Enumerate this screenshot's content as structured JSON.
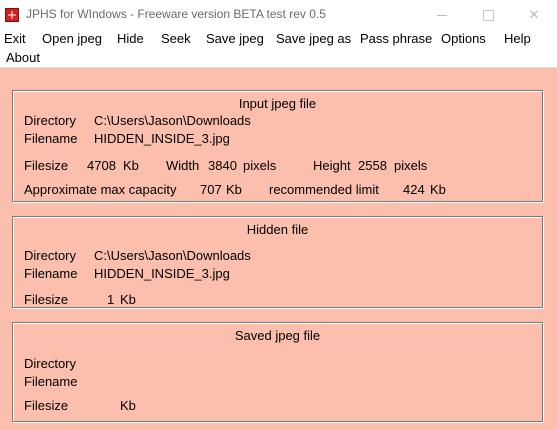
{
  "window": {
    "title": "JPHS for WIndows - Freeware version BETA test rev 0.5",
    "close_glyph": "✕"
  },
  "menu": {
    "items": [
      "Exit",
      "Open jpeg",
      "Hide",
      "Seek",
      "Save jpeg",
      "Save jpeg as",
      "Pass phrase",
      "Options",
      "Help",
      "About"
    ]
  },
  "input_jpeg": {
    "title": "Input jpeg file",
    "directory_label": "Directory",
    "directory_value": "C:\\Users\\Jason\\Downloads",
    "filename_label": "Filename",
    "filename_value": "HIDDEN_INSIDE_3.jpg",
    "filesize_label": "Filesize",
    "filesize_value": "4708",
    "filesize_unit": "Kb",
    "width_label": "Width",
    "width_value": "3840",
    "width_unit": "pixels",
    "height_label": "Height",
    "height_value": "2558",
    "height_unit": "pixels",
    "capacity_label": "Approximate max capacity",
    "capacity_value": "707",
    "capacity_unit": "Kb",
    "limit_label": "recommended limit",
    "limit_value": "424",
    "limit_unit": "Kb"
  },
  "hidden_file": {
    "title": "Hidden file",
    "directory_label": "Directory",
    "directory_value": "C:\\Users\\Jason\\Downloads",
    "filename_label": "Filename",
    "filename_value": "HIDDEN_INSIDE_3.jpg",
    "filesize_label": "Filesize",
    "filesize_value": "1",
    "filesize_unit": "Kb"
  },
  "saved_jpeg": {
    "title": "Saved jpeg file",
    "directory_label": "Directory",
    "filename_label": "Filename",
    "filesize_label": "Filesize",
    "filesize_unit": "Kb"
  },
  "colors": {
    "client_background": "#fcbfad",
    "app_icon": "#d02020"
  }
}
